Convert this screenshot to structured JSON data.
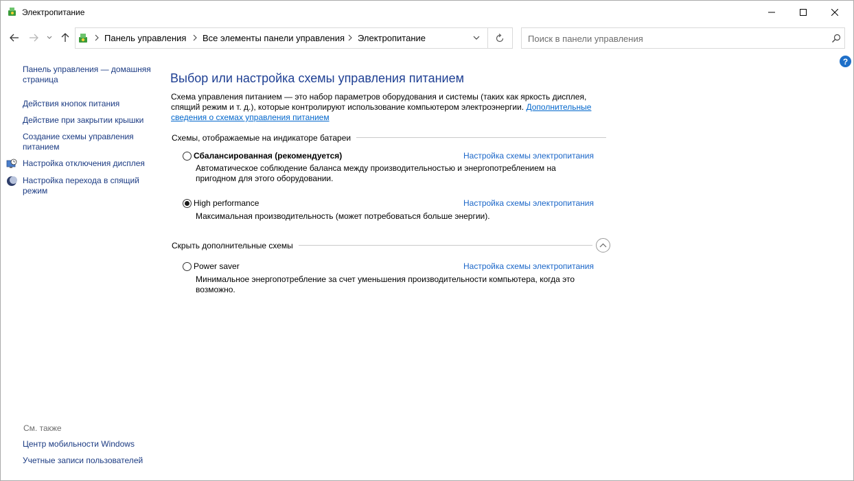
{
  "window": {
    "title": "Электропитание",
    "minimize_icon": "minimize-icon",
    "maximize_icon": "maximize-icon",
    "close_icon": "close-icon"
  },
  "nav": {
    "breadcrumbs": [
      "Панель управления",
      "Все элементы панели управления",
      "Электропитание"
    ],
    "search_placeholder": "Поиск в панели управления"
  },
  "left_pane": {
    "links": [
      "Панель управления — домашняя страница",
      "Действия кнопок питания",
      "Действие при закрытии крышки",
      "Создание схемы управления питанием",
      "Настройка отключения дисплея",
      "Настройка перехода в спящий режим"
    ],
    "link_lines": {
      "home_1": "Панель управления — домашняя",
      "home_2": "страница",
      "create_1": "Создание схемы управления",
      "create_2": "питанием",
      "sleep_1": "Настройка перехода в спящий",
      "sleep_2": "режим"
    },
    "see_also_label": "См. также",
    "see_also": [
      "Центр мобильности Windows",
      "Учетные записи пользователей"
    ]
  },
  "main": {
    "title": "Выбор или настройка схемы управления питанием",
    "description": "Схема управления питанием — это набор параметров оборудования и системы (таких как яркость дисплея, спящий режим и т. д.), которые контролируют использование компьютером электроэнергии.",
    "description_link": "Дополнительные сведения о схемах управления питанием",
    "battery_group_label": "Схемы, отображаемые на индикаторе батареи",
    "hidden_group_label": "Скрыть дополнительные схемы",
    "plans": [
      {
        "name": "Сбалансированная (рекомендуется)",
        "description": "Автоматическое соблюдение баланса между производительностью и энергопотреблением на пригодном для этого оборудовании.",
        "link": "Настройка схемы электропитания",
        "selected": false
      },
      {
        "name": "High performance",
        "description": "Максимальная производительность (может потребоваться больше энергии).",
        "link": "Настройка схемы электропитания",
        "selected": true
      },
      {
        "name": "Power saver",
        "description": "Минимальное энергопотребление за счет уменьшения производительности компьютера, когда это возможно.",
        "link": "Настройка схемы электропитания",
        "selected": false
      }
    ]
  },
  "colors": {
    "heading_blue": "#1e3f93",
    "link_blue": "#1a66c8",
    "left_link": "#1a3a82",
    "help_blue": "#1e6fc8"
  }
}
